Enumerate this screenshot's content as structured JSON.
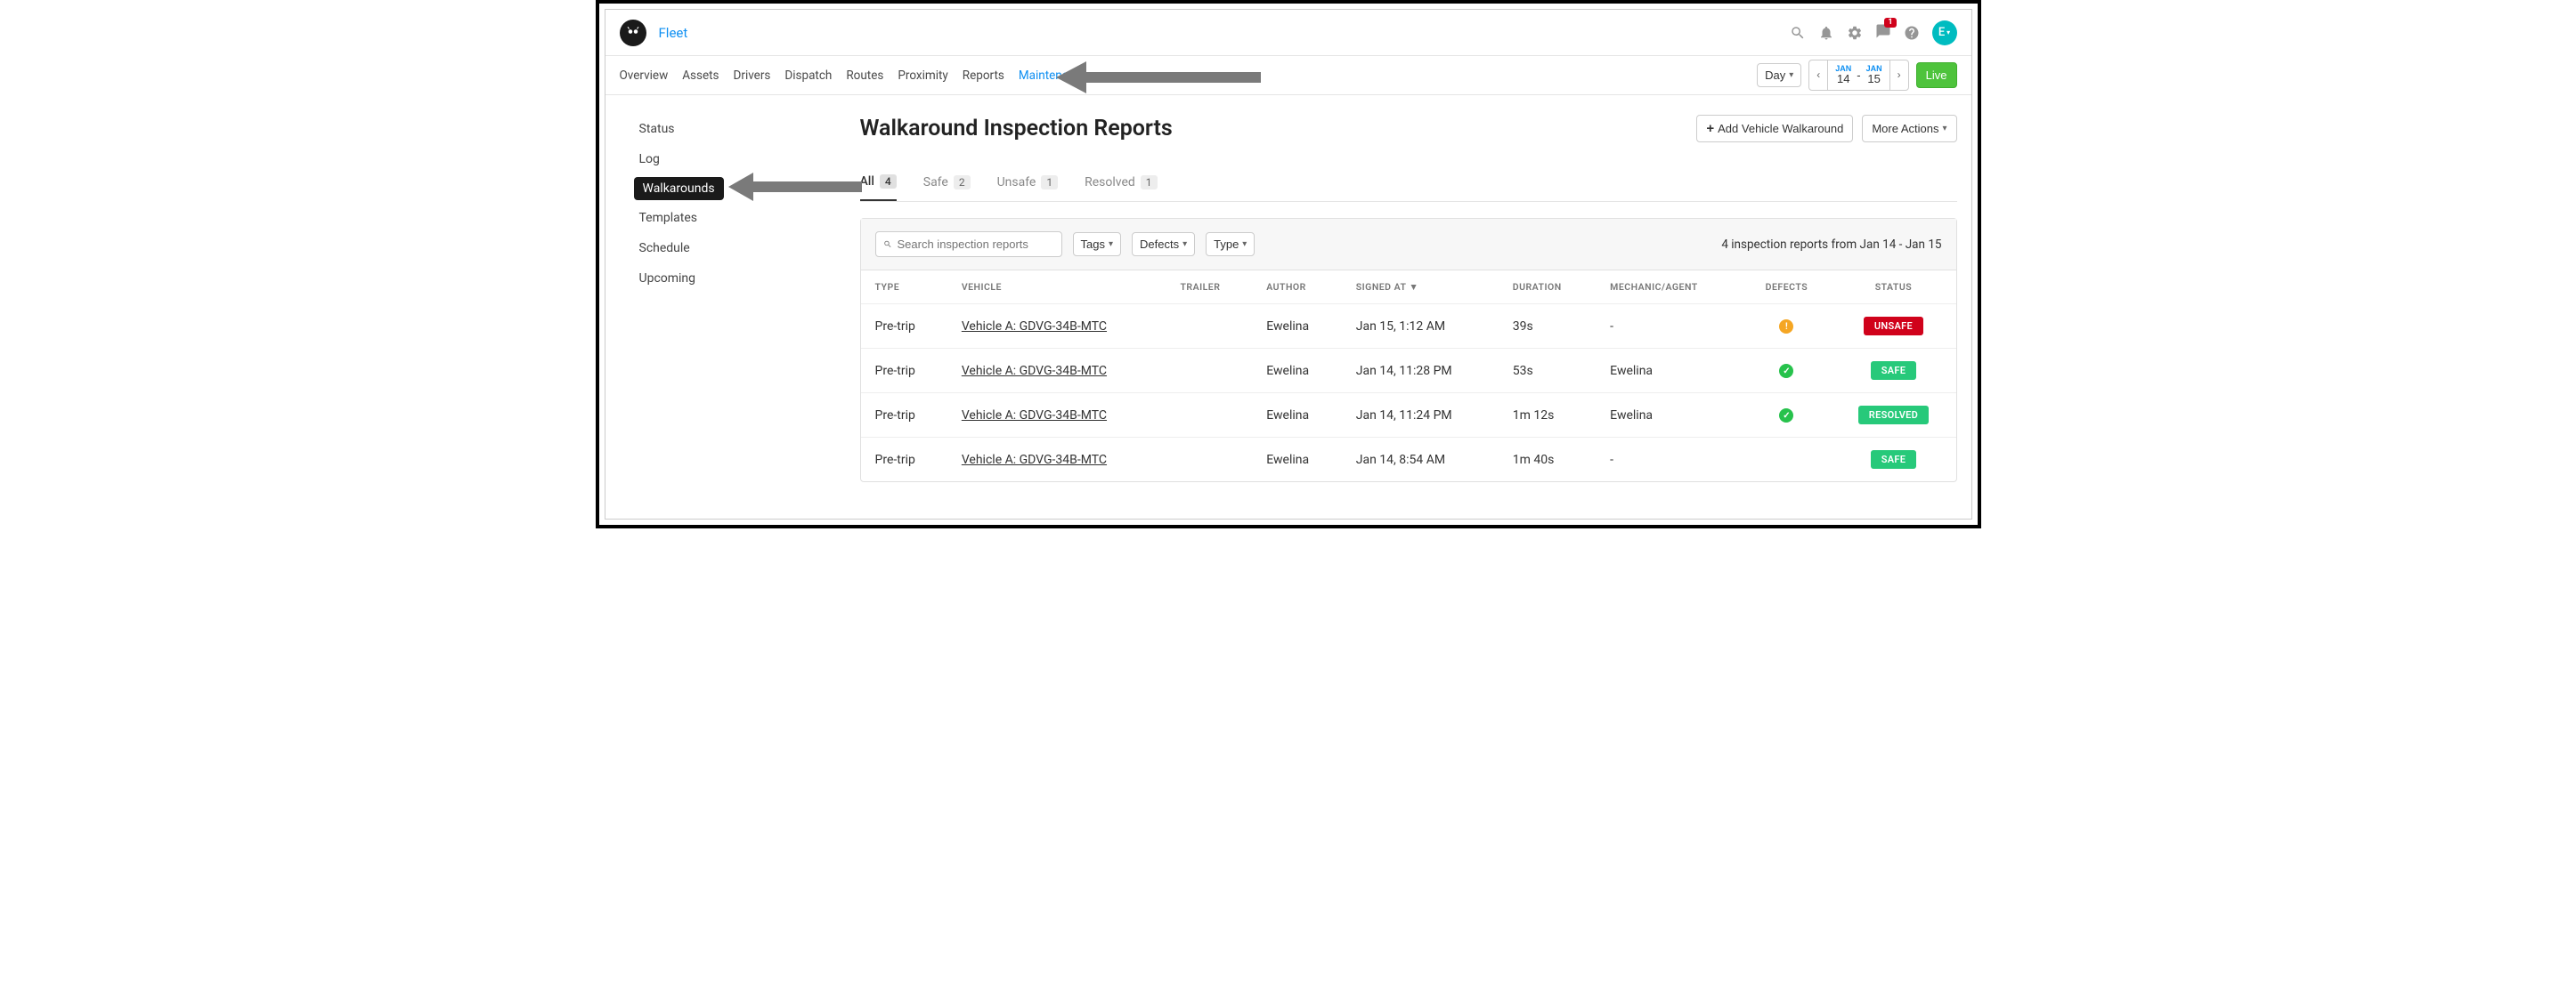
{
  "brand": "Fleet",
  "avatar_letter": "E",
  "notif_count": "1",
  "nav": {
    "items": [
      "Overview",
      "Assets",
      "Drivers",
      "Dispatch",
      "Routes",
      "Proximity",
      "Reports",
      "Maintenance"
    ],
    "active": "Maintenance"
  },
  "date_selector": {
    "granularity": "Day",
    "from_month": "JAN",
    "from_day": "14",
    "to_month": "JAN",
    "to_day": "15"
  },
  "live_label": "Live",
  "sidebar": {
    "items": [
      "Status",
      "Log",
      "Walkarounds",
      "Templates",
      "Schedule",
      "Upcoming"
    ],
    "active": "Walkarounds"
  },
  "page": {
    "title": "Walkaround Inspection Reports",
    "add_button": "Add Vehicle Walkaround",
    "more_actions": "More Actions"
  },
  "tabs": [
    {
      "label": "All",
      "count": "4",
      "active": true
    },
    {
      "label": "Safe",
      "count": "2",
      "active": false
    },
    {
      "label": "Unsafe",
      "count": "1",
      "active": false
    },
    {
      "label": "Resolved",
      "count": "1",
      "active": false
    }
  ],
  "filters": {
    "search_placeholder": "Search inspection reports",
    "tags": "Tags",
    "defects": "Defects",
    "type": "Type",
    "summary": "4 inspection reports from Jan 14 - Jan 15"
  },
  "table": {
    "headers": [
      "TYPE",
      "VEHICLE",
      "TRAILER",
      "AUTHOR",
      "SIGNED AT",
      "DURATION",
      "MECHANIC/AGENT",
      "DEFECTS",
      "STATUS"
    ],
    "rows": [
      {
        "type": "Pre-trip",
        "vehicle": "Vehicle A: GDVG-34B-MTC",
        "trailer": "",
        "author": "Ewelina",
        "signed": "Jan 15, 1:12 AM",
        "duration": "39s",
        "mechanic": "-",
        "defect": "warn",
        "status": "UNSAFE",
        "status_class": "unsafe"
      },
      {
        "type": "Pre-trip",
        "vehicle": "Vehicle A: GDVG-34B-MTC",
        "trailer": "",
        "author": "Ewelina",
        "signed": "Jan 14, 11:28 PM",
        "duration": "53s",
        "mechanic": "Ewelina",
        "defect": "ok",
        "status": "SAFE",
        "status_class": "safe"
      },
      {
        "type": "Pre-trip",
        "vehicle": "Vehicle A: GDVG-34B-MTC",
        "trailer": "",
        "author": "Ewelina",
        "signed": "Jan 14, 11:24 PM",
        "duration": "1m 12s",
        "mechanic": "Ewelina",
        "defect": "ok",
        "status": "RESOLVED",
        "status_class": "resolved"
      },
      {
        "type": "Pre-trip",
        "vehicle": "Vehicle A: GDVG-34B-MTC",
        "trailer": "",
        "author": "Ewelina",
        "signed": "Jan 14, 8:54 AM",
        "duration": "1m 40s",
        "mechanic": "-",
        "defect": "",
        "status": "SAFE",
        "status_class": "safe"
      }
    ]
  }
}
